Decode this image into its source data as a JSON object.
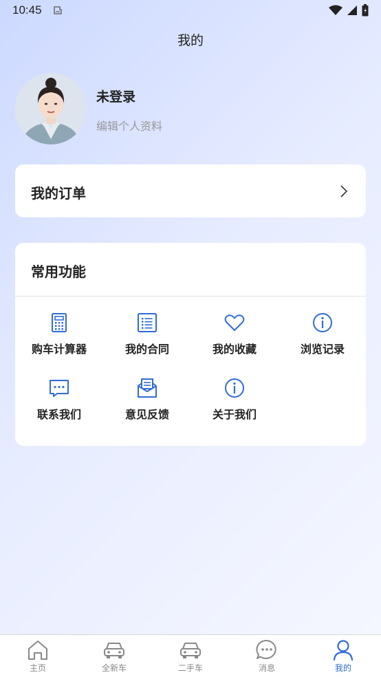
{
  "status_bar": {
    "time": "10:45"
  },
  "header": {
    "title": "我的"
  },
  "profile": {
    "name": "未登录",
    "edit_label": "编辑个人资料"
  },
  "orders": {
    "label": "我的订单"
  },
  "functions": {
    "title": "常用功能",
    "items": [
      {
        "label": "购车计算器",
        "icon": "calculator-icon"
      },
      {
        "label": "我的合同",
        "icon": "list-document-icon"
      },
      {
        "label": "我的收藏",
        "icon": "heart-icon"
      },
      {
        "label": "浏览记录",
        "icon": "info-icon"
      },
      {
        "label": "联系我们",
        "icon": "chat-bubble-icon"
      },
      {
        "label": "意见反馈",
        "icon": "envelope-icon"
      },
      {
        "label": "关于我们",
        "icon": "info-icon"
      }
    ]
  },
  "bottom_nav": {
    "items": [
      {
        "label": "主页",
        "icon": "home-icon"
      },
      {
        "label": "全新车",
        "icon": "car-icon"
      },
      {
        "label": "二手车",
        "icon": "car-icon"
      },
      {
        "label": "消息",
        "icon": "message-icon"
      },
      {
        "label": "我的",
        "icon": "person-icon"
      }
    ],
    "active": "我的"
  },
  "colors": {
    "accent": "#2f6bd8",
    "icon_inactive": "#888888",
    "card": "#ffffff"
  }
}
